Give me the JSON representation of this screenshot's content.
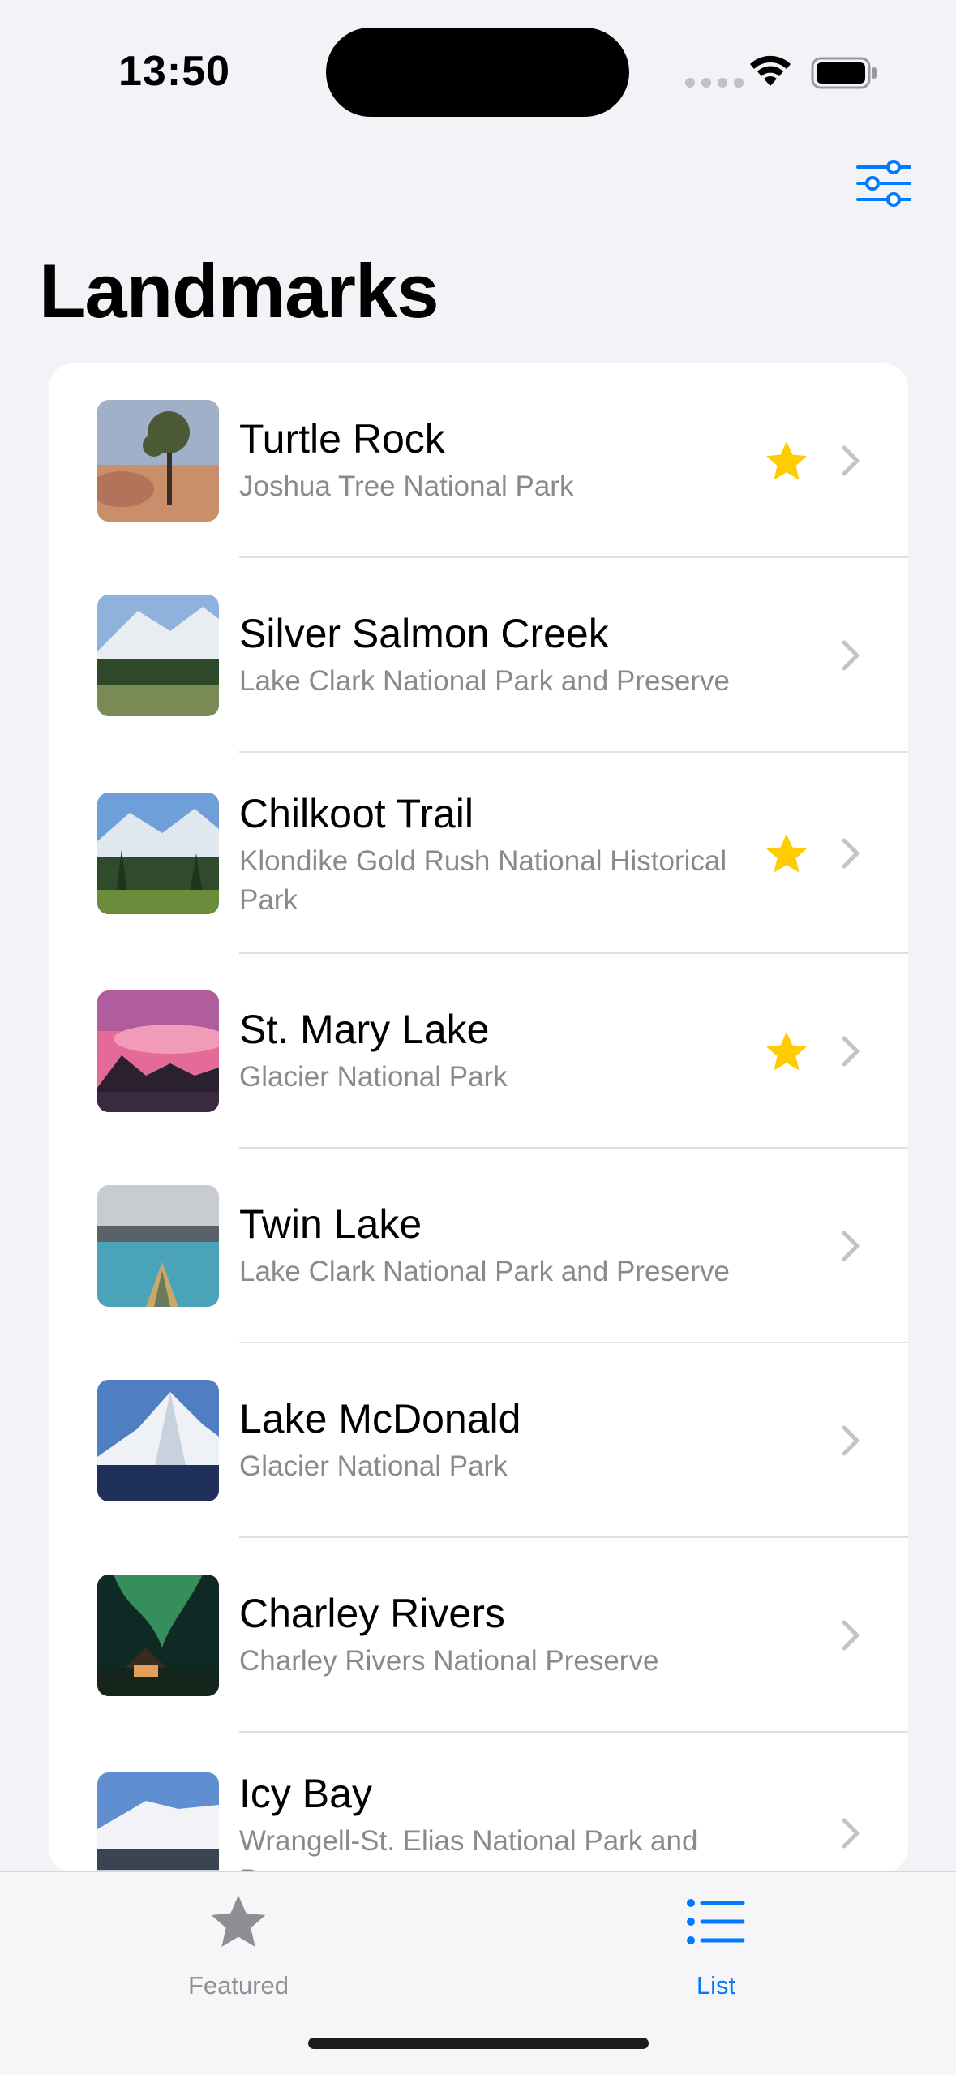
{
  "status_bar": {
    "time": "13:50"
  },
  "nav": {
    "title": "Landmarks"
  },
  "colors": {
    "accent": "#007aff",
    "favorite": "#ffcc00",
    "secondary_text": "#8a8a8e"
  },
  "landmarks": [
    {
      "name": "Turtle Rock",
      "park": "Joshua Tree National Park",
      "favorite": true
    },
    {
      "name": "Silver Salmon Creek",
      "park": "Lake Clark National Park and Preserve",
      "favorite": false
    },
    {
      "name": "Chilkoot Trail",
      "park": "Klondike Gold Rush National Historical Park",
      "favorite": true
    },
    {
      "name": "St. Mary Lake",
      "park": "Glacier National Park",
      "favorite": true
    },
    {
      "name": "Twin Lake",
      "park": "Lake Clark National Park and Preserve",
      "favorite": false
    },
    {
      "name": "Lake McDonald",
      "park": "Glacier National Park",
      "favorite": false
    },
    {
      "name": "Charley Rivers",
      "park": "Charley Rivers National Preserve",
      "favorite": false
    },
    {
      "name": "Icy Bay",
      "park": "Wrangell-St. Elias National Park and Preserve",
      "favorite": false
    }
  ],
  "tabs": [
    {
      "label": "Featured",
      "icon": "star-icon",
      "selected": false
    },
    {
      "label": "List",
      "icon": "list-icon",
      "selected": true
    }
  ]
}
